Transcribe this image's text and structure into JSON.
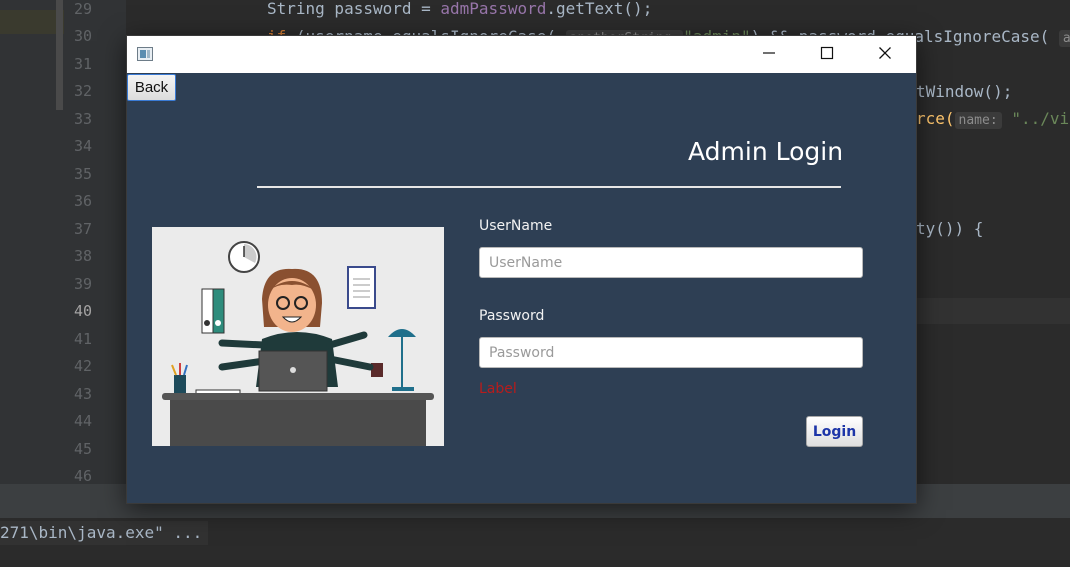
{
  "ide": {
    "line_numbers": [
      "29",
      "30",
      "31",
      "32",
      "33",
      "34",
      "35",
      "36",
      "37",
      "38",
      "39",
      "40",
      "41",
      "42",
      "43",
      "44",
      "45",
      "46"
    ],
    "code": {
      "l29_a": "String password = ",
      "l29_var": "admPassword",
      "l29_b": ".getText();",
      "l30_kw": "if",
      "l30_a": " (username.equalsIgnoreCase( ",
      "l30_hint": "anotherString:",
      "l30_str": "\"admin\"",
      "l30_b": ") && password.equalsIgnoreCase( ",
      "l30_c": "a",
      "l32_a": "tWindow();",
      "l33_a": "rce(",
      "l33_hint": "name:",
      "l33_str": "\"../vi",
      "l37_a": "ty()) {"
    },
    "console": "271\\bin\\java.exe\" ..."
  },
  "window": {
    "back_label": "Back",
    "title": "Admin Login",
    "username_label": "UserName",
    "username_placeholder": "UserName",
    "username_value": "",
    "password_label": "Password",
    "password_placeholder": "Password",
    "password_value": "",
    "error_label": "Label",
    "login_label": "Login"
  },
  "colors": {
    "window_bg": "#2e3f54",
    "error_text": "#b71c1c",
    "login_text": "#1d35a8"
  },
  "icons": [
    "app-icon",
    "minimize-icon",
    "maximize-icon",
    "close-icon"
  ]
}
